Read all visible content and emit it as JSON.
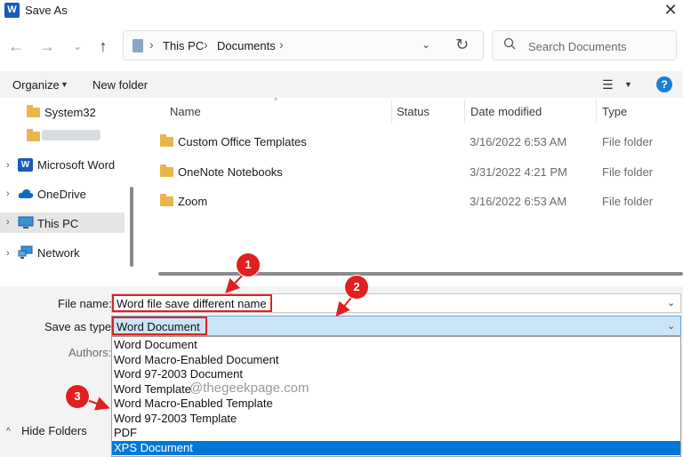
{
  "window": {
    "title": "Save As",
    "app_icon_letter": "W",
    "close_glyph": "✕"
  },
  "nav": {
    "back_glyph": "←",
    "forward_glyph": "→",
    "recent_glyph": "⌄",
    "up_glyph": "↑",
    "breadcrumbs": [
      "This PC",
      "Documents"
    ],
    "crumb_separator": "›",
    "dropdown_glyph": "⌄",
    "refresh_glyph": "↻",
    "search_placeholder": "Search Documents"
  },
  "toolbar": {
    "organize_label": "Organize",
    "caret": "▼",
    "new_folder_label": "New folder",
    "view_glyph": "☰",
    "help_glyph": "?"
  },
  "sidebar": {
    "items": [
      {
        "label": "System32",
        "icon": "folder-icon"
      },
      {
        "label": "",
        "icon": "folder-icon"
      },
      {
        "label": "Microsoft Word",
        "icon": "word-icon"
      },
      {
        "label": "OneDrive",
        "icon": "cloud-icon"
      },
      {
        "label": "This PC",
        "icon": "computer-icon"
      },
      {
        "label": "Network",
        "icon": "network-icon"
      }
    ],
    "chevron": "›"
  },
  "filelist": {
    "columns": [
      "Name",
      "Status",
      "Date modified",
      "Type"
    ],
    "sort_glyph": "^",
    "rows": [
      {
        "name": "Custom Office Templates",
        "date": "3/16/2022 6:53 AM",
        "type": "File folder"
      },
      {
        "name": "OneNote Notebooks",
        "date": "3/31/2022 4:21 PM",
        "type": "File folder"
      },
      {
        "name": "Zoom",
        "date": "3/16/2022 6:53 AM",
        "type": "File folder"
      }
    ]
  },
  "form": {
    "filename_label": "File name:",
    "filename_value": "Word file save different name",
    "savetype_label": "Save as type:",
    "savetype_value": "Word Document",
    "authors_label": "Authors:",
    "caret": "⌄",
    "options": [
      "Word Document",
      "Word Macro-Enabled Document",
      "Word 97-2003 Document",
      "Word Template",
      "Word Macro-Enabled Template",
      "Word 97-2003 Template",
      "PDF",
      "XPS Document"
    ],
    "selected_option": "XPS Document",
    "hide_folders_label": "Hide Folders",
    "hide_folders_glyph": "^"
  },
  "annotations": {
    "badges": [
      "1",
      "2",
      "3"
    ],
    "watermark": "@thegeekpage.com",
    "color": "#e02020"
  }
}
